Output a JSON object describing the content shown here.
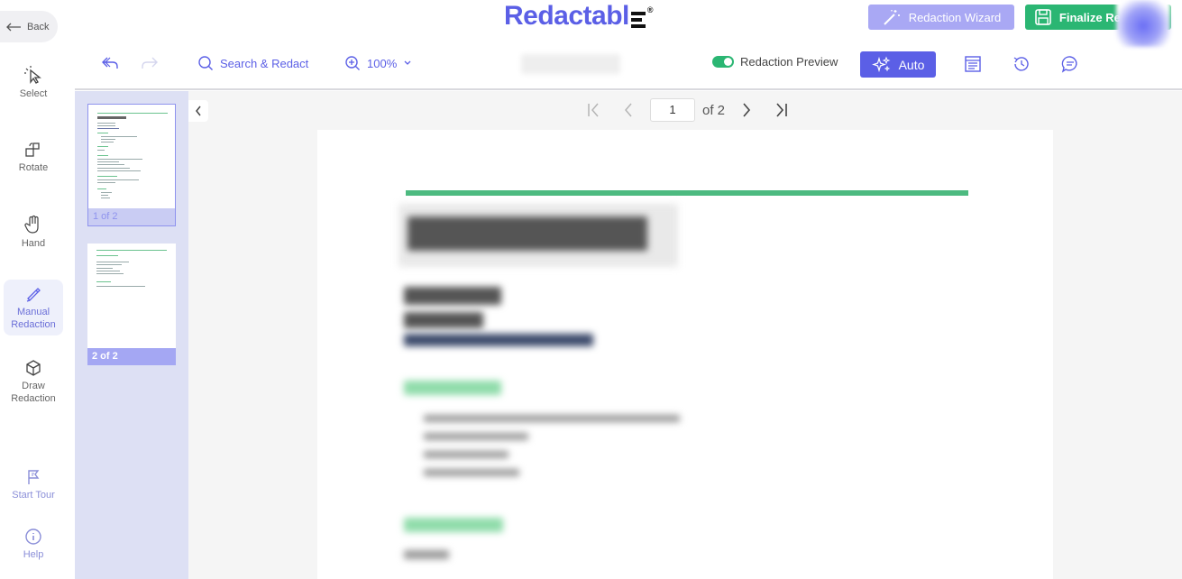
{
  "rail": {
    "back": "Back",
    "tools": [
      {
        "label": "Select"
      },
      {
        "label": "Rotate"
      },
      {
        "label": "Hand"
      },
      {
        "label": "Manual\nRedaction"
      },
      {
        "label": "Draw\nRedaction"
      },
      {
        "label": "Start Tour"
      },
      {
        "label": "Help"
      }
    ]
  },
  "header": {
    "brand": "Redactabl",
    "registered": "®",
    "wizard_label": "Redaction Wizard",
    "finalize_label": "Finalize Redaction"
  },
  "toolbar": {
    "search_label": "Search & Redact",
    "zoom_value": "100%",
    "preview_label": "Redaction Preview",
    "auto_label": "Auto"
  },
  "thumbnails": [
    {
      "label": "1 of 2"
    },
    {
      "label": "2 of 2"
    }
  ],
  "pager": {
    "current_page": "1",
    "total_label": "of 2"
  },
  "colors": {
    "accent": "#5b5fe6",
    "success": "#2bb673",
    "wizard": "#a9a8f4"
  }
}
